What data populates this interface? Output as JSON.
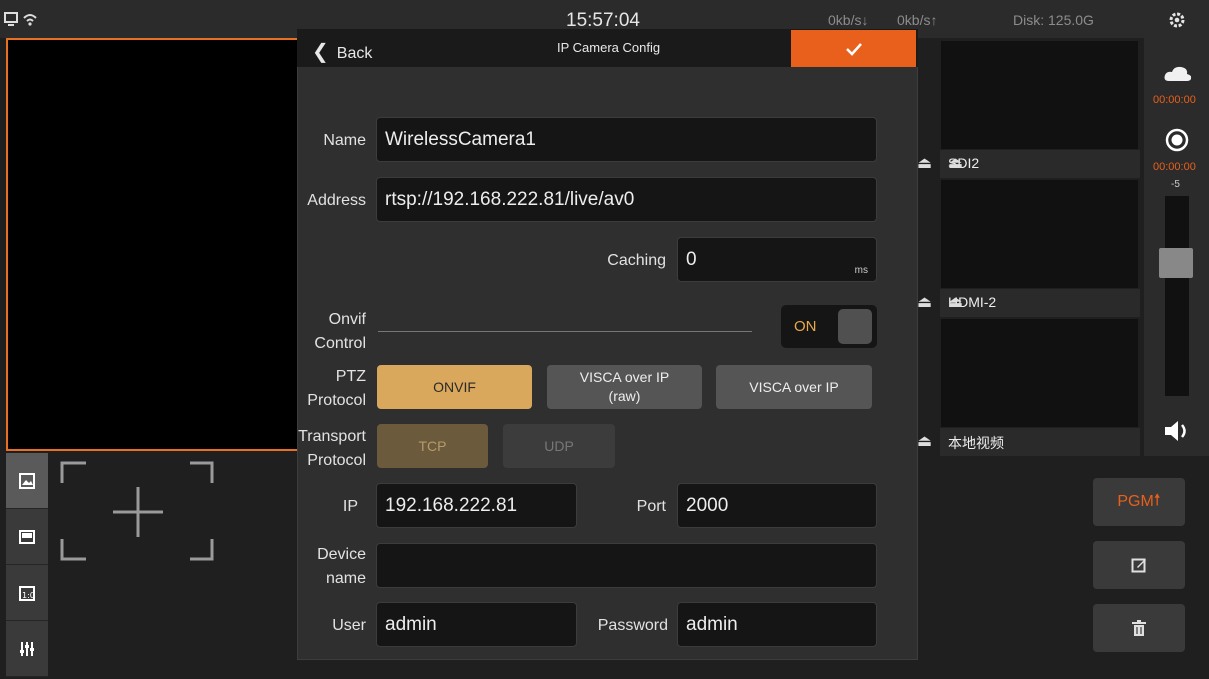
{
  "status_bar": {
    "time": "15:57:04",
    "down_rate": "0kb/s↓",
    "up_rate": "0kb/s↑",
    "disk": "Disk: 125.0G"
  },
  "dialog": {
    "back_label": "Back",
    "title": "IP Camera Config",
    "confirm_icon": "check-icon",
    "name_label": "Name",
    "name_value": "WirelessCamera1",
    "address_label": "Address",
    "address_value": "rtsp://192.168.222.81/live/av0",
    "caching_label": "Caching",
    "caching_value": "0",
    "caching_unit": "ms",
    "onvif_label_1": "Onvif",
    "onvif_label_2": "Control",
    "onvif_toggle": "ON",
    "ptz_label_1": "PTZ",
    "ptz_label_2": "Protocol",
    "ptz_options": [
      "ONVIF",
      "VISCA over IP\n(raw)",
      "VISCA over IP"
    ],
    "ptz_selected": "ONVIF",
    "transport_label_1": "Transport",
    "transport_label_2": "Protocol",
    "transport_options": [
      "TCP",
      "UDP"
    ],
    "transport_selected": "TCP",
    "ip_label": "IP",
    "ip_value": "192.168.222.81",
    "port_label": "Port",
    "port_value": "2000",
    "device_label_1": "Device",
    "device_label_2": "name",
    "device_value": "",
    "user_label": "User",
    "user_value": "admin",
    "password_label": "Password",
    "password_value": "admin"
  },
  "sources": [
    {
      "label": "SDI2"
    },
    {
      "label": "HDMI-2"
    },
    {
      "label": "本地视频"
    }
  ],
  "right_panel": {
    "stream_timer": "00:00:00",
    "record_timer": "00:00:00",
    "volume_top": "-5",
    "pgm_label": "PGM"
  },
  "colors": {
    "accent": "#e8601c",
    "selected_option": "#d9a85c",
    "disabled_selected": "#6b5a3c"
  }
}
